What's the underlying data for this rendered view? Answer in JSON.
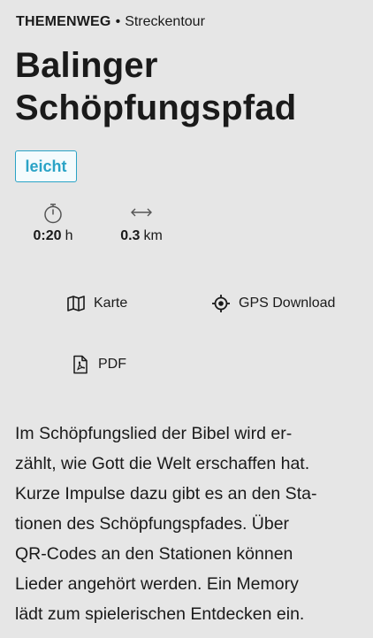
{
  "header": {
    "type": "THEMENWEG",
    "separator": "•",
    "subtype": "Streckentour",
    "title_line1": "Balinger",
    "title_line2": "Schöpfungspfad"
  },
  "difficulty": {
    "label": "leicht",
    "color": "#2aa3c6"
  },
  "stats": {
    "duration": {
      "icon": "stopwatch-icon",
      "value": "0:20",
      "unit": "h"
    },
    "distance": {
      "icon": "distance-arrows-icon",
      "value": "0.3",
      "unit": "km"
    }
  },
  "actions": {
    "map": {
      "icon": "map-icon",
      "label": "Karte"
    },
    "gps": {
      "icon": "gps-target-icon",
      "label": "GPS Download"
    },
    "pdf": {
      "icon": "pdf-file-icon",
      "label": "PDF"
    }
  },
  "description": {
    "lines": [
      "Im Schöpfungslied der Bibel wird er-",
      "zählt, wie Gott die Welt erschaffen hat.",
      "Kurze Impulse dazu gibt es an den Sta-",
      "tionen des Schöpfungspfades. Über",
      "QR-Codes an den Stationen können",
      "Lieder angehört werden. Ein Memory",
      "lädt zum spielerischen Entdecken ein."
    ]
  }
}
